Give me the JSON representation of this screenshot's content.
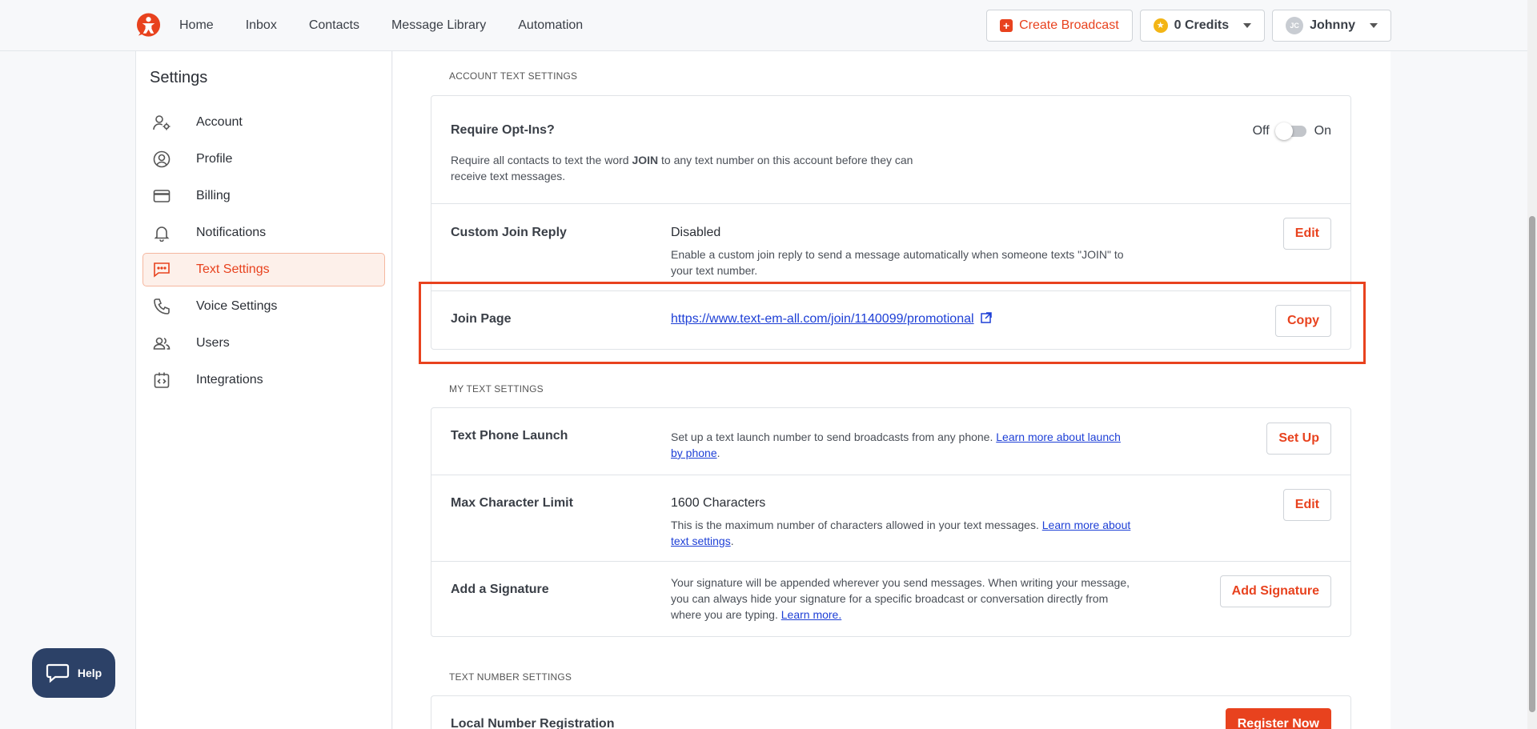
{
  "nav": {
    "links": [
      "Home",
      "Inbox",
      "Contacts",
      "Message Library",
      "Automation"
    ],
    "create_broadcast": "Create Broadcast",
    "credits": "0 Credits",
    "user_initials": "JC",
    "user_name": "Johnny",
    "brand_color": "#e8421e"
  },
  "sidebar": {
    "title": "Settings",
    "items": [
      {
        "label": "Account",
        "icon": "user-gear-icon"
      },
      {
        "label": "Profile",
        "icon": "user-circle-icon"
      },
      {
        "label": "Billing",
        "icon": "credit-card-icon"
      },
      {
        "label": "Notifications",
        "icon": "bell-icon"
      },
      {
        "label": "Text Settings",
        "icon": "chat-icon",
        "active": true
      },
      {
        "label": "Voice Settings",
        "icon": "phone-icon"
      },
      {
        "label": "Users",
        "icon": "users-icon"
      },
      {
        "label": "Integrations",
        "icon": "code-icon"
      }
    ]
  },
  "account_text": {
    "heading": "ACCOUNT TEXT SETTINGS",
    "opt_in": {
      "label": "Require Opt-Ins?",
      "off": "Off",
      "on": "On",
      "desc_1": "Require all contacts to text the word ",
      "desc_bold": "JOIN",
      "desc_2": " to any text number on this account before they can receive text messages."
    },
    "join_reply": {
      "label": "Custom Join Reply",
      "value": "Disabled",
      "desc": "Enable a custom join reply to send a message automatically when someone texts \"JOIN\" to your text number.",
      "button": "Edit"
    },
    "join_page": {
      "label": "Join Page",
      "link": "https://www.text-em-all.com/join/1140099/promotional",
      "button": "Copy"
    }
  },
  "my_text": {
    "heading": "MY TEXT SETTINGS",
    "launch": {
      "label": "Text Phone Launch",
      "desc": "Set up a text launch number to send broadcasts from any phone. ",
      "link": "Learn more about launch by phone",
      "desc_end": ".",
      "button": "Set Up"
    },
    "max_char": {
      "label": "Max Character Limit",
      "value": "1600 Characters",
      "desc": "This is the maximum number of characters allowed in your text messages. ",
      "link": "Learn more about text settings",
      "desc_end": ".",
      "button": "Edit"
    },
    "signature": {
      "label": "Add a Signature",
      "desc": "Your signature will be appended wherever you send messages. When writing your message, you can always hide your signature for a specific broadcast or conversation directly from where you are typing. ",
      "link": "Learn more.",
      "button": "Add Signature"
    }
  },
  "text_number": {
    "heading": "TEXT NUMBER SETTINGS",
    "local": {
      "label": "Local Number Registration",
      "button": "Register Now"
    }
  },
  "help": {
    "label": "Help"
  }
}
